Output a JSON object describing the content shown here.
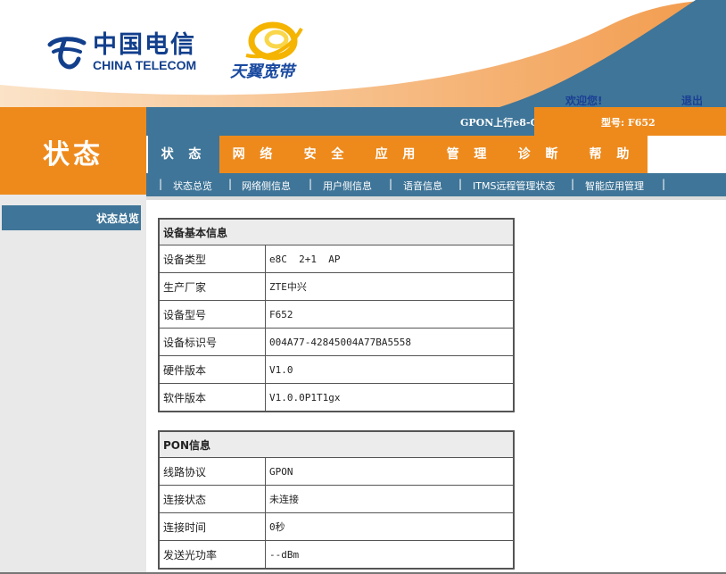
{
  "header": {
    "logo_cn": "中国电信",
    "logo_en": "CHINA TELECOM",
    "broadband_logo": "天翼宽带",
    "welcome": "欢迎您!",
    "logout": "退出"
  },
  "info_bar": {
    "gpon_status": "GPON上行e8-C",
    "model": "型号: F652"
  },
  "page_title": "状态",
  "menu": {
    "tabs": [
      "状 态",
      "网 络",
      "安 全",
      "应 用",
      "管 理",
      "诊 断",
      "帮 助"
    ],
    "active_index": 0
  },
  "submenu": {
    "items": [
      "状态总览",
      "网络侧信息",
      "用户侧信息",
      "语音信息",
      "ITMS远程管理状态",
      "智能应用管理"
    ]
  },
  "left_nav": {
    "items": [
      "状态总览"
    ]
  },
  "device_info": {
    "title": "设备基本信息",
    "rows": [
      {
        "label": "设备类型",
        "value": "e8C  2+1  AP"
      },
      {
        "label": "生产厂家",
        "value": "ZTE中兴"
      },
      {
        "label": "设备型号",
        "value": "F652"
      },
      {
        "label": "设备标识号",
        "value": "004A77-42845004A77BA5558"
      },
      {
        "label": "硬件版本",
        "value": "V1.0"
      },
      {
        "label": "软件版本",
        "value": "V1.0.0P1T1gx"
      }
    ]
  },
  "pon_info": {
    "title": "PON信息",
    "rows": [
      {
        "label": "线路协议",
        "value": "GPON"
      },
      {
        "label": "连接状态",
        "value": "未连接"
      },
      {
        "label": "连接时间",
        "value": "0秒"
      },
      {
        "label": "发送光功率",
        "value": "--dBm"
      }
    ]
  },
  "colors": {
    "orange": "#ee8a1c",
    "steel_blue": "#3f7598",
    "logo_blue": "#123f8c"
  }
}
